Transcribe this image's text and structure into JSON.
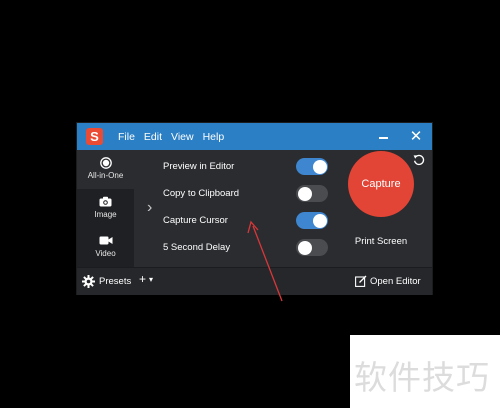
{
  "app": {
    "logo_letter": "S",
    "menu": [
      "File",
      "Edit",
      "View",
      "Help"
    ],
    "window_controls": {
      "minimize": "",
      "close": "✕"
    }
  },
  "modes": [
    {
      "label": "All-in-One",
      "icon": "all-in-one-icon",
      "selected": true
    },
    {
      "label": "Image",
      "icon": "camera-icon",
      "selected": false
    },
    {
      "label": "Video",
      "icon": "video-camera-icon",
      "selected": false
    }
  ],
  "expand_chevron": "›",
  "options": [
    {
      "label": "Preview in Editor",
      "on": true
    },
    {
      "label": "Copy to Clipboard",
      "on": false
    },
    {
      "label": "Capture Cursor",
      "on": true
    },
    {
      "label": "5 Second Delay",
      "on": false
    }
  ],
  "capture": {
    "button_label": "Capture",
    "shortcut": "Print Screen"
  },
  "footer": {
    "presets_label": "Presets",
    "add_label": "+",
    "add_chevron": "▾",
    "open_editor_label": "Open Editor"
  },
  "watermark": {
    "text": "软件技巧"
  },
  "colors": {
    "titlebar": "#2b7fc4",
    "capture": "#e24436",
    "toggle_on": "#3e86cf",
    "toggle_off": "#4a4c50",
    "annotation_arrow": "#d9373a",
    "logo": "#e94b35"
  }
}
